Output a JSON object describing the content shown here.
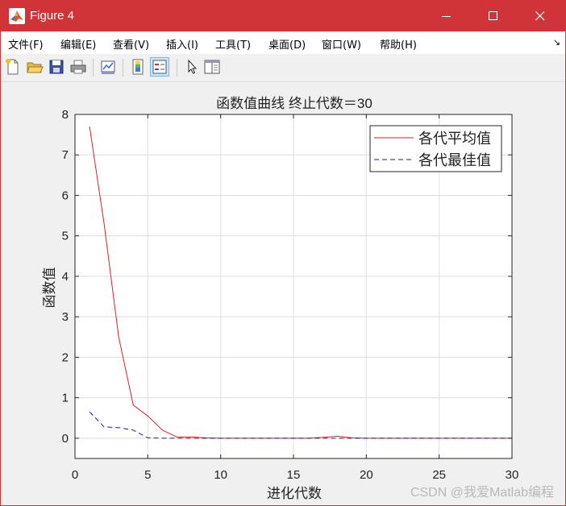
{
  "window": {
    "title": "Figure 4"
  },
  "menu": [
    "文件(F)",
    "编辑(E)",
    "查看(V)",
    "插入(I)",
    "工具(T)",
    "桌面(D)",
    "窗口(W)",
    "帮助(H)"
  ],
  "figure": {
    "title": "函数值曲线  终止代数＝30",
    "watermark": "CSDN @我爱Matlab编程"
  },
  "chart_data": {
    "type": "line",
    "title": "函数值曲线  终止代数＝30",
    "xlabel": "进化代数",
    "ylabel": "函数值",
    "xlim": [
      0,
      30
    ],
    "ylim": [
      -0.5,
      8
    ],
    "xticks": [
      0,
      5,
      10,
      15,
      20,
      25,
      30
    ],
    "yticks": [
      0,
      1,
      2,
      3,
      4,
      5,
      6,
      7,
      8
    ],
    "grid": true,
    "legend_position": "top-right",
    "x": [
      1,
      2,
      3,
      4,
      5,
      6,
      7,
      8,
      9,
      10,
      11,
      12,
      13,
      14,
      15,
      16,
      17,
      18,
      19,
      20,
      21,
      22,
      23,
      24,
      25,
      26,
      27,
      28,
      29,
      30
    ],
    "series": [
      {
        "name": "各代平均值",
        "style": "solid",
        "color": "#e02020",
        "values": [
          7.7,
          5.3,
          2.5,
          0.82,
          0.55,
          0.2,
          0.03,
          0.03,
          0.01,
          0,
          0,
          0,
          0,
          0,
          0,
          0,
          0.02,
          0.05,
          0.01,
          0,
          0,
          0,
          0,
          0,
          0,
          0,
          0,
          0,
          0,
          0
        ]
      },
      {
        "name": "各代最佳值",
        "style": "dashed",
        "color": "#1a1aa6",
        "values": [
          0.65,
          0.28,
          0.26,
          0.2,
          0.01,
          0,
          0,
          0,
          0,
          0,
          0,
          0,
          0,
          0,
          0,
          0,
          0,
          0,
          0,
          0,
          0,
          0,
          0,
          0,
          0,
          0,
          0,
          0,
          0,
          0
        ]
      }
    ]
  }
}
